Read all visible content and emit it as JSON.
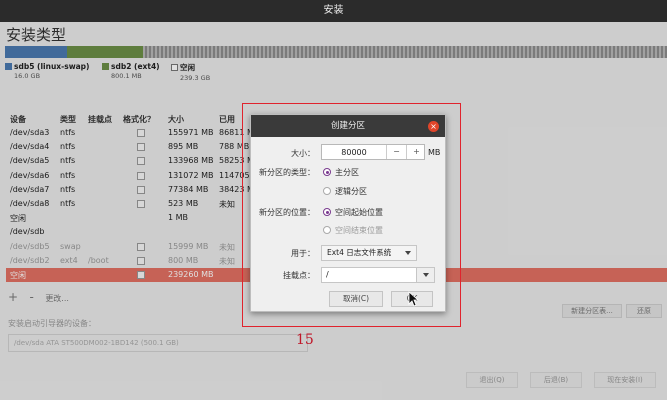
{
  "window": {
    "title": "安装"
  },
  "page": {
    "title": "安装类型"
  },
  "legend": [
    {
      "name": "sdb5 (linux-swap)",
      "size": "16.0 GB",
      "color": "#4b79b0"
    },
    {
      "name": "sdb2 (ext4)",
      "size": "800.1 MB",
      "color": "#6b8f46"
    },
    {
      "name": "空闲",
      "size": "239.3 GB",
      "color": "#ffffff"
    }
  ],
  "table": {
    "headers": {
      "device": "设备",
      "type": "类型",
      "mount": "挂载点",
      "format": "格式化？",
      "size": "大小",
      "used": "已用"
    },
    "rows": [
      {
        "device": "/dev/sda3",
        "type": "ntfs",
        "mount": "",
        "size": "155971 MB",
        "used": "86811 MB"
      },
      {
        "device": "/dev/sda4",
        "type": "ntfs",
        "mount": "",
        "size": "895 MB",
        "used": "788 MB"
      },
      {
        "device": "/dev/sda5",
        "type": "ntfs",
        "mount": "",
        "size": "133968 MB",
        "used": "58253 MB"
      },
      {
        "device": "/dev/sda6",
        "type": "ntfs",
        "mount": "",
        "size": "131072 MB",
        "used": "114705 MB"
      },
      {
        "device": "/dev/sda7",
        "type": "ntfs",
        "mount": "",
        "size": "77384 MB",
        "used": "38423 MB"
      },
      {
        "device": "/dev/sda8",
        "type": "ntfs",
        "mount": "",
        "size": "523 MB",
        "used": "未知"
      },
      {
        "device": "空闲",
        "type": "",
        "mount": "",
        "size": "1 MB",
        "used": ""
      },
      {
        "device": "/dev/sdb",
        "type": "",
        "mount": "",
        "size": "",
        "used": ""
      },
      {
        "device": "/dev/sdb5",
        "type": "swap",
        "mount": "",
        "size": "15999 MB",
        "used": "未知"
      },
      {
        "device": "/dev/sdb2",
        "type": "ext4",
        "mount": "/boot",
        "size": "800 MB",
        "used": "未知"
      },
      {
        "device": "空闲",
        "type": "",
        "mount": "",
        "size": "239260 MB",
        "used": ""
      }
    ]
  },
  "table_controls": {
    "add": "+",
    "remove": "-",
    "change": "更改...",
    "new_table": "新建分区表...",
    "revert": "还原"
  },
  "boot": {
    "label": "安装启动引导器的设备：",
    "value": "/dev/sda   ATA ST500DM002-1BD142 (500.1 GB)"
  },
  "bottom": {
    "quit": "退出(Q)",
    "back": "后退(B)",
    "install": "现在安装(I)"
  },
  "dialog": {
    "title": "创建分区",
    "size_label": "大小：",
    "size_value": "80000",
    "size_unit": "MB",
    "minus": "−",
    "plus": "+",
    "type_label": "新分区的类型：",
    "type_primary": "主分区",
    "type_logical": "逻辑分区",
    "location_label": "新分区的位置：",
    "location_start": "空间起始位置",
    "location_end": "空间结束位置",
    "use_label": "用于：",
    "use_value": "Ext4 日志文件系统",
    "mount_label": "挂载点：",
    "mount_value": "/",
    "cancel": "取消(C)",
    "ok": "OK"
  },
  "annotation": {
    "number": "15",
    "color": "#e0232d"
  }
}
